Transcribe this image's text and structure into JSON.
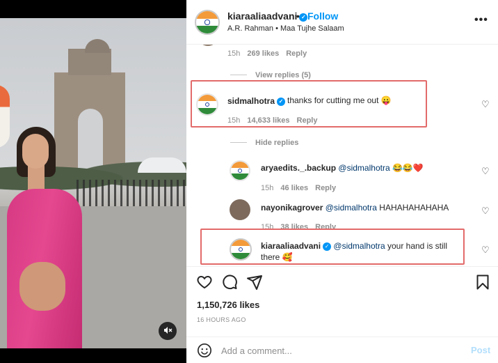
{
  "header": {
    "username": "kiaraaliaadvani",
    "follow_label": "Follow",
    "dot": "•",
    "music": "A.R. Rahman • Maa Tujhe Salaam",
    "more": "•••"
  },
  "comments": {
    "top_partial": {
      "time": "15h",
      "likes": "269 likes",
      "reply": "Reply"
    },
    "view_replies": "View replies (5)",
    "main": {
      "username": "sidmalhotra",
      "text": "thanks for cutting me out 😛",
      "time": "15h",
      "likes": "14,633 likes",
      "reply": "Reply"
    },
    "hide_replies": "Hide replies",
    "replies": [
      {
        "username": "aryaedits._.backup",
        "mention": "@sidmalhotra",
        "text": "😂😂❤️",
        "time": "15h",
        "likes": "46 likes",
        "reply": "Reply"
      },
      {
        "username": "nayonikagrover",
        "mention": "@sidmalhotra",
        "text": "HAHAHAHAHAHA",
        "time": "15h",
        "likes": "38 likes",
        "reply": "Reply"
      },
      {
        "username": "kiaraaliaadvani",
        "mention": "@sidmalhotra",
        "text": "your hand is still there 🥰"
      }
    ]
  },
  "actions": {
    "likes": "1,150,726 likes",
    "posted_ago": "16 HOURS AGO"
  },
  "add_comment": {
    "placeholder": "Add a comment...",
    "post_label": "Post"
  },
  "colors": {
    "accent": "#0095f6",
    "highlight_box": "#e36a6a",
    "post_disabled": "#b2dffc"
  },
  "icons": [
    "verified-badge-icon",
    "heart-icon",
    "comment-icon",
    "share-icon",
    "bookmark-icon",
    "emoji-icon",
    "mute-icon",
    "more-options-icon"
  ]
}
